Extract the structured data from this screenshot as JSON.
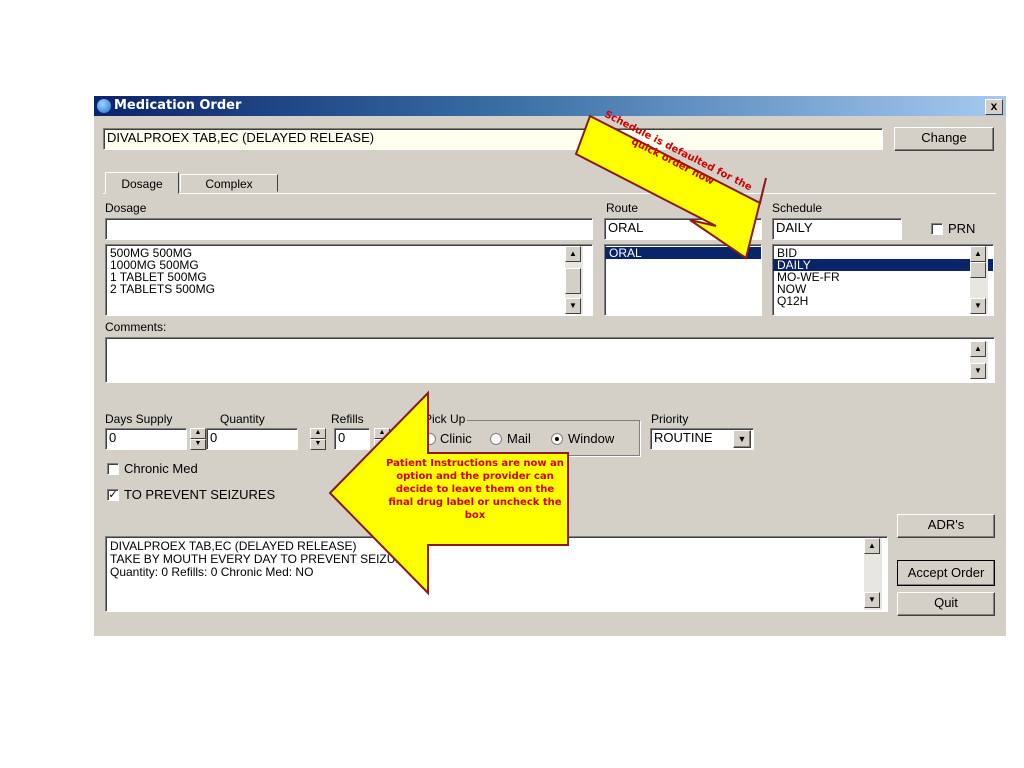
{
  "window": {
    "title": "Medication Order",
    "close_label": "x"
  },
  "drug": {
    "name": "DIVALPROEX TAB,EC (DELAYED RELEASE)",
    "change_label": "Change"
  },
  "tabs": [
    {
      "label": "Dosage"
    },
    {
      "label": "Complex"
    }
  ],
  "dosage": {
    "label": "Dosage",
    "value": "",
    "options": [
      "500MG 500MG",
      "1000MG 500MG",
      "1 TABLET 500MG",
      "2 TABLETS 500MG"
    ]
  },
  "route": {
    "label": "Route",
    "value": "ORAL",
    "options": [
      "ORAL"
    ],
    "selected": "ORAL"
  },
  "schedule": {
    "label": "Schedule",
    "value": "DAILY",
    "prn_label": "PRN",
    "options": [
      "BID",
      "DAILY",
      "MO-WE-FR",
      "NOW",
      "Q12H"
    ],
    "selected": "DAILY"
  },
  "comments": {
    "label": "Comments:",
    "value": ""
  },
  "days_supply": {
    "label": "Days Supply",
    "value": "0"
  },
  "quantity": {
    "label": "Quantity",
    "value": "0"
  },
  "refills": {
    "label": "Refills",
    "value": "0"
  },
  "pickup": {
    "label": "Pick Up",
    "options": [
      {
        "label": "Clinic",
        "checked": false
      },
      {
        "label": "Mail",
        "checked": false
      },
      {
        "label": "Window",
        "checked": true
      }
    ]
  },
  "priority": {
    "label": "Priority",
    "value": "ROUTINE"
  },
  "chronic_med": {
    "label": "Chronic Med",
    "checked": false
  },
  "patient_instructions": {
    "label": "TO PREVENT SEIZURES",
    "checked": true
  },
  "summary": {
    "line1": "DIVALPROEX TAB,EC (DELAYED RELEASE)",
    "line2": "TAKE  BY MOUTH EVERY DAY TO PREVENT SEIZURES",
    "line3": "Quantity: 0 Refills: 0 Chronic Med: NO"
  },
  "buttons": {
    "adr": "ADR's",
    "accept": "Accept Order",
    "quit": "Quit"
  },
  "callouts": {
    "schedule_note": "Schedule is defaulted for the quick order now",
    "instructions_note": "Patient Instructions are now an option and the provider can decide to leave them on the final drug label or uncheck the box"
  },
  "colors": {
    "title_gradient_start": "#0a246a",
    "selection": "#0a246a",
    "callout_fill": "#ffff00",
    "callout_border": "#8b1a1a",
    "callout_text": "#d40000"
  }
}
